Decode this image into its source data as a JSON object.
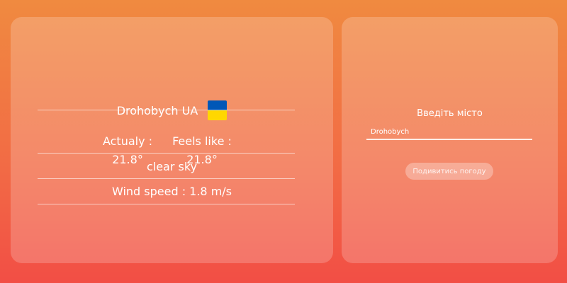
{
  "weather": {
    "city": "Drohobych UA",
    "flag": "ukraine-flag-icon",
    "actual_label": "Actualy :",
    "actual_value": "21.8°",
    "feels_label": "Feels like :",
    "feels_value": "21.8°",
    "description": "clear sky",
    "wind": "Wind speed : 1.8 m/s"
  },
  "search": {
    "label": "Введіть місто",
    "value": "Drohobych",
    "button": "Подивитись погоду"
  },
  "colors": {
    "flag_blue": "#0057b7",
    "flag_yellow": "#ffd700"
  }
}
